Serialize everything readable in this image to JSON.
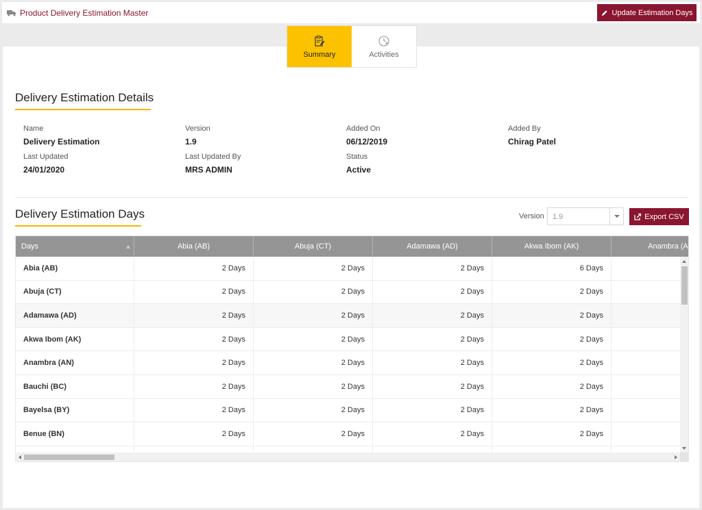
{
  "header": {
    "title": "Product Delivery Estimation Master",
    "update_button": "Update Estimation Days",
    "icon": "truck-icon"
  },
  "tabs": [
    {
      "label": "Summary",
      "icon": "clipboard-edit-icon",
      "active": true
    },
    {
      "label": "Activities",
      "icon": "clock-activity-icon",
      "active": false
    }
  ],
  "details": {
    "title": "Delivery Estimation Details",
    "name_label": "Name",
    "name_value": "Delivery Estimation",
    "version_label": "Version",
    "version_value": "1.9",
    "added_on_label": "Added On",
    "added_on_value": "06/12/2019",
    "added_by_label": "Added By",
    "added_by_value": "Chirag Patel",
    "last_updated_label": "Last Updated",
    "last_updated_value": "24/01/2020",
    "last_updated_by_label": "Last Updated By",
    "last_updated_by_value": "MRS ADMIN",
    "status_label": "Status",
    "status_value": "Active"
  },
  "days": {
    "title": "Delivery Estimation Days",
    "version_label": "Version",
    "version_selected": "1.9",
    "export_button": "Export CSV",
    "columns": [
      "Days",
      "Abia (AB)",
      "Abuja (CT)",
      "Adamawa (AD)",
      "Akwa Ibom (AK)",
      "Anambra (AN"
    ],
    "rows": [
      {
        "name": "Abia (AB)",
        "values": [
          "2 Days",
          "2 Days",
          "2 Days",
          "6 Days",
          ""
        ]
      },
      {
        "name": "Abuja (CT)",
        "values": [
          "2 Days",
          "2 Days",
          "2 Days",
          "2 Days",
          ""
        ]
      },
      {
        "name": "Adamawa (AD)",
        "values": [
          "2 Days",
          "2 Days",
          "2 Days",
          "2 Days",
          ""
        ]
      },
      {
        "name": "Akwa Ibom (AK)",
        "values": [
          "2 Days",
          "2 Days",
          "2 Days",
          "2 Days",
          ""
        ]
      },
      {
        "name": "Anambra (AN)",
        "values": [
          "2 Days",
          "2 Days",
          "2 Days",
          "2 Days",
          ""
        ]
      },
      {
        "name": "Bauchi (BC)",
        "values": [
          "2 Days",
          "2 Days",
          "2 Days",
          "2 Days",
          ""
        ]
      },
      {
        "name": "Bayelsa (BY)",
        "values": [
          "2 Days",
          "2 Days",
          "2 Days",
          "2 Days",
          ""
        ]
      },
      {
        "name": "Benue (BN)",
        "values": [
          "2 Days",
          "2 Days",
          "2 Days",
          "2 Days",
          ""
        ]
      },
      {
        "name": "",
        "values": [
          "",
          "",
          "",
          "",
          ""
        ]
      }
    ]
  },
  "colors": {
    "brand": "#8a1530",
    "accent": "#fcc200",
    "grid_header": "#959595"
  }
}
